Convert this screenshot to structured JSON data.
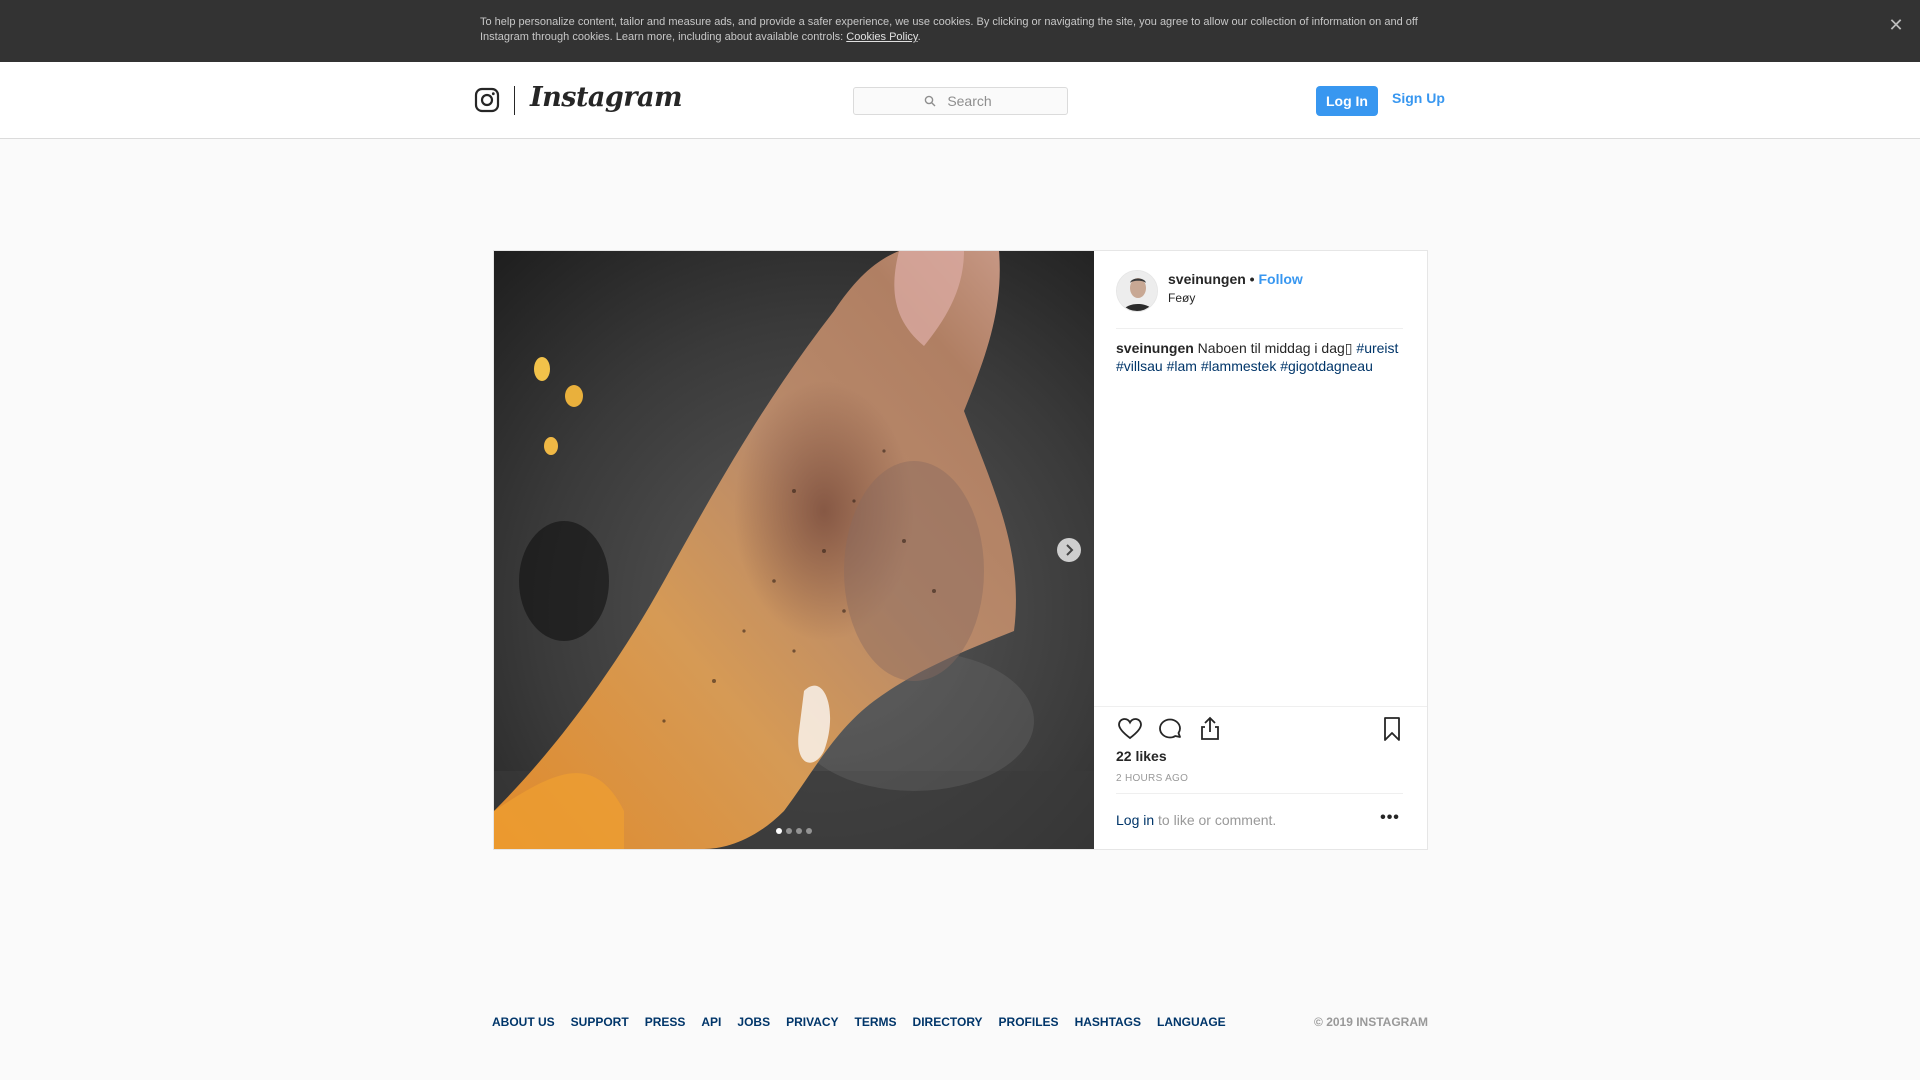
{
  "cookie_banner": {
    "text": "To help personalize content, tailor and measure ads, and provide a safer experience, we use cookies. By clicking or navigating the site, you agree to allow our collection of information on and off Instagram through cookies. Learn more, including about available controls: ",
    "link": "Cookies Policy",
    "end": ".",
    "close_icon": "close-icon"
  },
  "header": {
    "wordmark": "Instagram",
    "search_placeholder": "Search",
    "login_label": "Log In",
    "signup_label": "Sign Up",
    "icons": [
      "instagram-glyph-icon",
      "search-icon"
    ]
  },
  "post": {
    "username": "sveinungen",
    "bullet": " • ",
    "follow_label": "Follow",
    "location": "Feøy",
    "caption_text": " Naboen til middag i dag",
    "caption_emoji": "▯",
    "hashtags": [
      "#ureist",
      "#villsau",
      "#lam",
      "#lammestek",
      "#gigotdagneau"
    ],
    "likes": "22 likes",
    "time": "2 HOURS AGO",
    "comment_login": "Log in",
    "comment_rest": " to like or comment.",
    "more_label": "•••",
    "carousel": {
      "slides": 4,
      "active": 1
    },
    "icons": [
      "heart-icon",
      "comment-icon",
      "share-icon",
      "bookmark-icon",
      "chevron-right-icon"
    ]
  },
  "footer": {
    "links": [
      "ABOUT US",
      "SUPPORT",
      "PRESS",
      "API",
      "JOBS",
      "PRIVACY",
      "TERMS",
      "DIRECTORY",
      "PROFILES",
      "HASHTAGS",
      "LANGUAGE"
    ],
    "copyright": "© 2019 INSTAGRAM"
  },
  "colors": {
    "accent": "#3897f0",
    "link_dark": "#003569",
    "banner_bg": "#333333",
    "page_bg": "#fafafa"
  }
}
